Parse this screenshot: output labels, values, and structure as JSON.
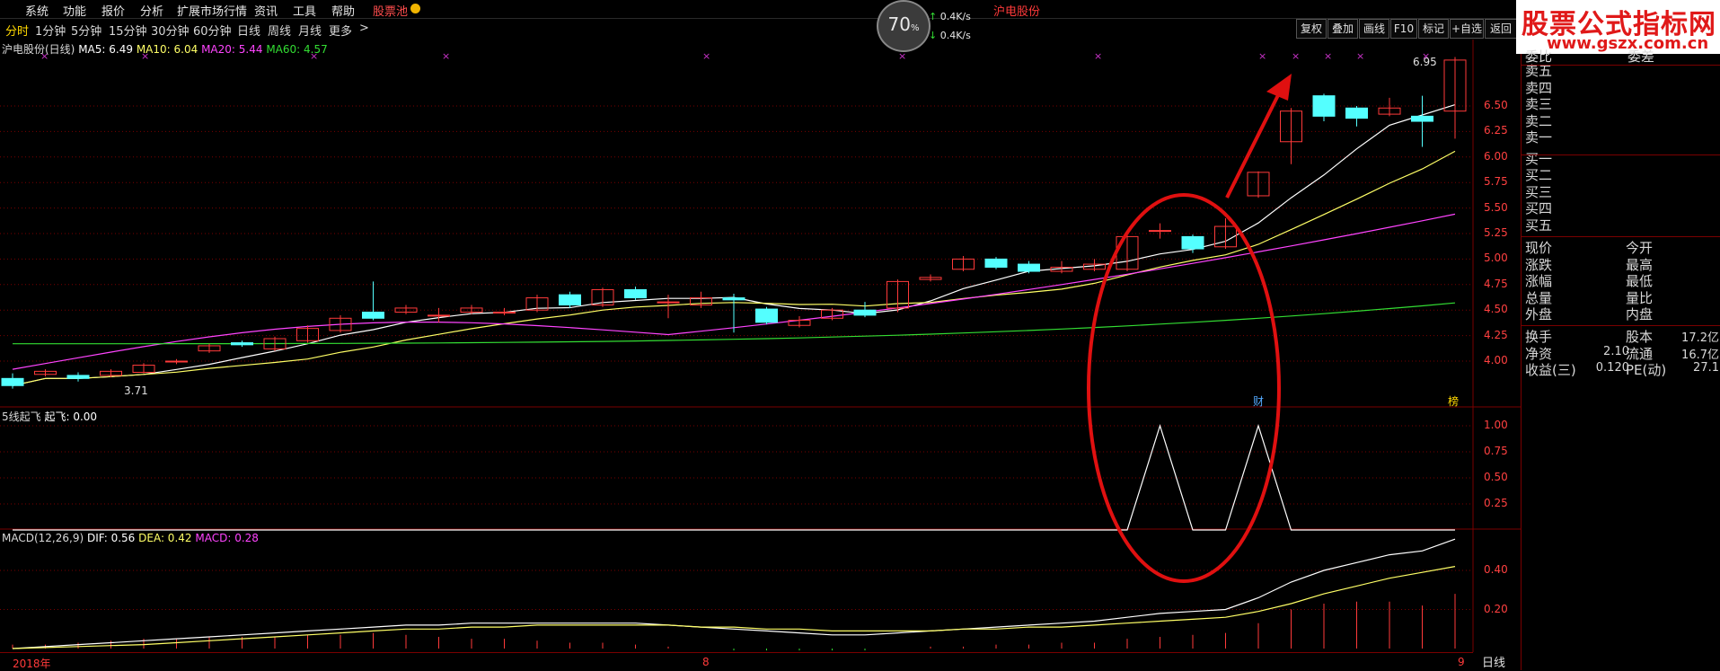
{
  "menu": [
    "系统",
    "功能",
    "报价",
    "分析",
    "扩展市场行情",
    "资讯",
    "工具",
    "帮助",
    "股票池"
  ],
  "periods": [
    "分时",
    "1分钟",
    "5分钟",
    "15分钟",
    "30分钟",
    "60分钟",
    "日线",
    "周线",
    "月线",
    "更多",
    ">"
  ],
  "toolbar_right": [
    "复权",
    "叠加",
    "画线",
    "F10",
    "标记",
    "+自选",
    "返回"
  ],
  "speed": {
    "pct": "70",
    "pct_unit": "%",
    "up": "0.4K/s",
    "down": "0.4K/s"
  },
  "ticker": {
    "prefix": "沪电股份"
  },
  "brand": {
    "title": "股票公式指标网",
    "url": "www.gszx.com.cn"
  },
  "main_legend": {
    "name": "沪电股份(日线)",
    "ma5": "MA5: 6.49",
    "ma10": "MA10: 6.04",
    "ma20": "MA20: 5.44",
    "ma60": "MA60: 4.57"
  },
  "ind_legend": {
    "name": "5线起飞",
    "value": "起飞: 0.00"
  },
  "macd_legend": {
    "name": "MACD(12,26,9)",
    "dif": "DIF: 0.56",
    "dea": "DEA: 0.42",
    "macd": "MACD: 0.28"
  },
  "price_ticks": [
    "6.50",
    "6.25",
    "6.00",
    "5.75",
    "5.50",
    "5.25",
    "5.00",
    "4.75",
    "4.50",
    "4.25",
    "4.00"
  ],
  "ind_ticks": [
    "1.00",
    "0.75",
    "0.50",
    "0.25"
  ],
  "macd_ticks": [
    "0.40",
    "0.20"
  ],
  "labels": {
    "high": "6.95",
    "low": "3.71",
    "cai": "财",
    "bang": "榜"
  },
  "bottom": {
    "year": "2018年",
    "month": "8",
    "day": "9",
    "tab": "日线"
  },
  "orderbook": {
    "header_left": "委比",
    "header_right": "委差",
    "sell": [
      "卖五",
      "卖四",
      "卖三",
      "卖二",
      "卖一"
    ],
    "buy": [
      "买一",
      "买二",
      "买三",
      "买四",
      "买五"
    ]
  },
  "quote": [
    {
      "l": "现价",
      "lv": "",
      "m": "今开",
      "mv": ""
    },
    {
      "l": "涨跌",
      "lv": "",
      "m": "最高",
      "mv": ""
    },
    {
      "l": "涨幅",
      "lv": "",
      "m": "最低",
      "mv": ""
    },
    {
      "l": "总量",
      "lv": "",
      "m": "量比",
      "mv": ""
    },
    {
      "l": "外盘",
      "lv": "",
      "m": "内盘",
      "mv": ""
    }
  ],
  "finance": [
    {
      "l": "换手",
      "lv": "",
      "m": "股本",
      "mv": "17.2亿"
    },
    {
      "l": "净资",
      "lv": "2.10",
      "m": "流通",
      "mv": "16.7亿"
    },
    {
      "l": "收益(三)",
      "lv": "0.120",
      "m": "PE(动)",
      "mv": "27.1"
    }
  ],
  "colors": {
    "up": "#ff3a3a",
    "down": "#54ffff",
    "ma5": "#ffffff",
    "ma10": "#ffff66",
    "ma20": "#ff44ff",
    "ma60": "#33dd33",
    "grid": "#7a0000",
    "annot": "#e01010"
  },
  "chart_data": {
    "type": "candlestick",
    "ylim": [
      3.71,
      6.95
    ],
    "candles": [
      [
        3.83,
        3.76,
        3.88,
        3.73
      ],
      [
        3.87,
        3.9,
        3.92,
        3.85
      ],
      [
        3.86,
        3.83,
        3.89,
        3.8
      ],
      [
        3.86,
        3.9,
        3.92,
        3.84
      ],
      [
        3.89,
        3.96,
        3.98,
        3.88
      ],
      [
        4.0,
        4.0,
        4.02,
        3.97
      ],
      [
        4.1,
        4.15,
        4.17,
        4.08
      ],
      [
        4.18,
        4.16,
        4.2,
        4.14
      ],
      [
        4.12,
        4.22,
        4.24,
        4.1
      ],
      [
        4.2,
        4.32,
        4.35,
        4.18
      ],
      [
        4.3,
        4.42,
        4.45,
        4.28
      ],
      [
        4.48,
        4.42,
        4.78,
        4.4
      ],
      [
        4.48,
        4.52,
        4.55,
        4.46
      ],
      [
        4.45,
        4.45,
        4.52,
        4.38
      ],
      [
        4.48,
        4.52,
        4.55,
        4.46
      ],
      [
        4.48,
        4.48,
        4.52,
        4.45
      ],
      [
        4.5,
        4.62,
        4.65,
        4.48
      ],
      [
        4.65,
        4.55,
        4.68,
        4.52
      ],
      [
        4.55,
        4.7,
        4.72,
        4.53
      ],
      [
        4.7,
        4.62,
        4.73,
        4.6
      ],
      [
        4.58,
        4.58,
        4.65,
        4.42
      ],
      [
        4.55,
        4.62,
        4.68,
        4.52
      ],
      [
        4.62,
        4.6,
        4.66,
        4.28
      ],
      [
        4.51,
        4.38,
        4.53,
        4.36
      ],
      [
        4.35,
        4.4,
        4.44,
        4.33
      ],
      [
        4.42,
        4.5,
        4.52,
        4.4
      ],
      [
        4.5,
        4.45,
        4.58,
        4.43
      ],
      [
        4.52,
        4.78,
        4.8,
        4.48
      ],
      [
        4.8,
        4.82,
        4.85,
        4.78
      ],
      [
        4.9,
        5.0,
        5.03,
        4.88
      ],
      [
        5.0,
        4.92,
        5.02,
        4.9
      ],
      [
        4.95,
        4.88,
        4.98,
        4.86
      ],
      [
        4.88,
        4.92,
        4.98,
        4.86
      ],
      [
        4.9,
        4.95,
        5.0,
        4.88
      ],
      [
        4.9,
        5.22,
        5.24,
        4.88
      ],
      [
        5.28,
        5.28,
        5.35,
        5.2
      ],
      [
        5.22,
        5.1,
        5.24,
        5.06
      ],
      [
        5.12,
        5.32,
        5.4,
        5.1
      ],
      [
        5.62,
        5.85,
        5.86,
        5.6
      ],
      [
        6.15,
        6.45,
        6.48,
        5.93
      ],
      [
        6.6,
        6.4,
        6.62,
        6.35
      ],
      [
        6.48,
        6.38,
        6.5,
        6.3
      ],
      [
        6.42,
        6.48,
        6.58,
        6.4
      ],
      [
        6.4,
        6.35,
        6.6,
        6.1
      ],
      [
        6.45,
        6.95,
        6.98,
        6.18
      ]
    ],
    "macd_dif": [
      0.0,
      0.01,
      0.02,
      0.03,
      0.04,
      0.05,
      0.06,
      0.07,
      0.08,
      0.09,
      0.1,
      0.11,
      0.12,
      0.12,
      0.13,
      0.13,
      0.13,
      0.13,
      0.13,
      0.13,
      0.12,
      0.11,
      0.1,
      0.09,
      0.08,
      0.07,
      0.07,
      0.08,
      0.09,
      0.1,
      0.11,
      0.12,
      0.13,
      0.14,
      0.16,
      0.18,
      0.19,
      0.2,
      0.26,
      0.34,
      0.4,
      0.44,
      0.48,
      0.5,
      0.56
    ],
    "macd_dea": [
      0.0,
      0.005,
      0.01,
      0.015,
      0.02,
      0.03,
      0.04,
      0.05,
      0.06,
      0.07,
      0.08,
      0.09,
      0.1,
      0.1,
      0.11,
      0.11,
      0.12,
      0.12,
      0.12,
      0.12,
      0.12,
      0.11,
      0.11,
      0.1,
      0.1,
      0.09,
      0.09,
      0.09,
      0.09,
      0.1,
      0.1,
      0.11,
      0.11,
      0.12,
      0.13,
      0.14,
      0.15,
      0.16,
      0.19,
      0.23,
      0.28,
      0.32,
      0.36,
      0.39,
      0.42
    ],
    "macd_bar": [
      0.02,
      0.02,
      0.03,
      0.04,
      0.05,
      0.05,
      0.06,
      0.06,
      0.06,
      0.07,
      0.07,
      0.08,
      0.07,
      0.06,
      0.05,
      0.05,
      0.04,
      0.03,
      0.03,
      0.02,
      0.01,
      0.0,
      -0.01,
      -0.01,
      -0.01,
      -0.01,
      -0.01,
      0.0,
      0.01,
      0.01,
      0.02,
      0.02,
      0.03,
      0.03,
      0.05,
      0.06,
      0.07,
      0.08,
      0.13,
      0.2,
      0.23,
      0.24,
      0.24,
      0.22,
      0.28
    ],
    "signal": [
      0,
      0,
      0,
      0,
      0,
      0,
      0,
      0,
      0,
      0,
      0,
      0,
      0,
      0,
      0,
      0,
      0,
      0,
      0,
      0,
      0,
      0,
      0,
      0,
      0,
      0,
      0,
      0,
      0,
      0,
      0,
      0,
      0,
      0,
      0,
      1,
      0,
      0,
      1,
      0,
      0,
      0,
      0,
      0,
      0
    ]
  }
}
